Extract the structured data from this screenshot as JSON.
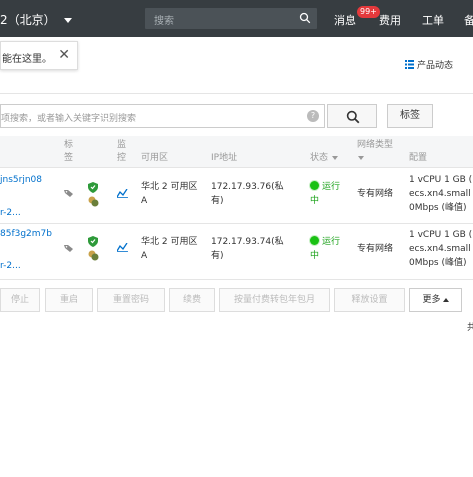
{
  "topbar": {
    "region": "2（北京）",
    "search_placeholder": "搜索",
    "nav": [
      {
        "label": "消息"
      },
      {
        "label": "费用"
      },
      {
        "label": "工单"
      },
      {
        "label": "备"
      }
    ],
    "message_badge": "99+",
    "colors": {
      "bar": "#373d41",
      "badge": "#e4393c"
    }
  },
  "tip": {
    "text": "能在这里。",
    "close": "✕"
  },
  "product_dynamic": "产品动态",
  "search": {
    "placeholder": "项搜索，或者输入关键字识别搜索",
    "help": "?",
    "tag_button": "标签"
  },
  "table": {
    "headers": {
      "tag": [
        "标",
        "签"
      ],
      "monitor": [
        "监",
        "控"
      ],
      "zone": "可用区",
      "ip": "IP地址",
      "status": "状态",
      "network": [
        "网络类型"
      ],
      "config": "配置"
    },
    "rows": [
      {
        "id": "jns5rjn08",
        "name": "r-2...",
        "zone": [
          "华北 2 可用区",
          "A"
        ],
        "ip": [
          "172.17.93.76(私",
          "有)"
        ],
        "status": [
          "运行",
          "中"
        ],
        "network": "专有网络",
        "config": [
          "1 vCPU 1 GB (",
          "ecs.xn4.small",
          "0Mbps (峰值)"
        ]
      },
      {
        "id": "85f3g2m7b",
        "name": "r-2...",
        "zone": [
          "华北 2 可用区",
          "A"
        ],
        "ip": [
          "172.17.93.74(私",
          "有)"
        ],
        "status": [
          "运行",
          "中"
        ],
        "network": "专有网络",
        "config": [
          "1 vCPU 1 GB (",
          "ecs.xn4.small",
          "0Mbps (峰值)"
        ]
      }
    ]
  },
  "actions": {
    "stop": "停止",
    "restart": "重启",
    "reset_password": "重置密码",
    "renew": "续费",
    "switch_billing": "按量付费转包年包月",
    "release_settings": "释放设置",
    "more": "更多"
  },
  "pager_text": "共"
}
